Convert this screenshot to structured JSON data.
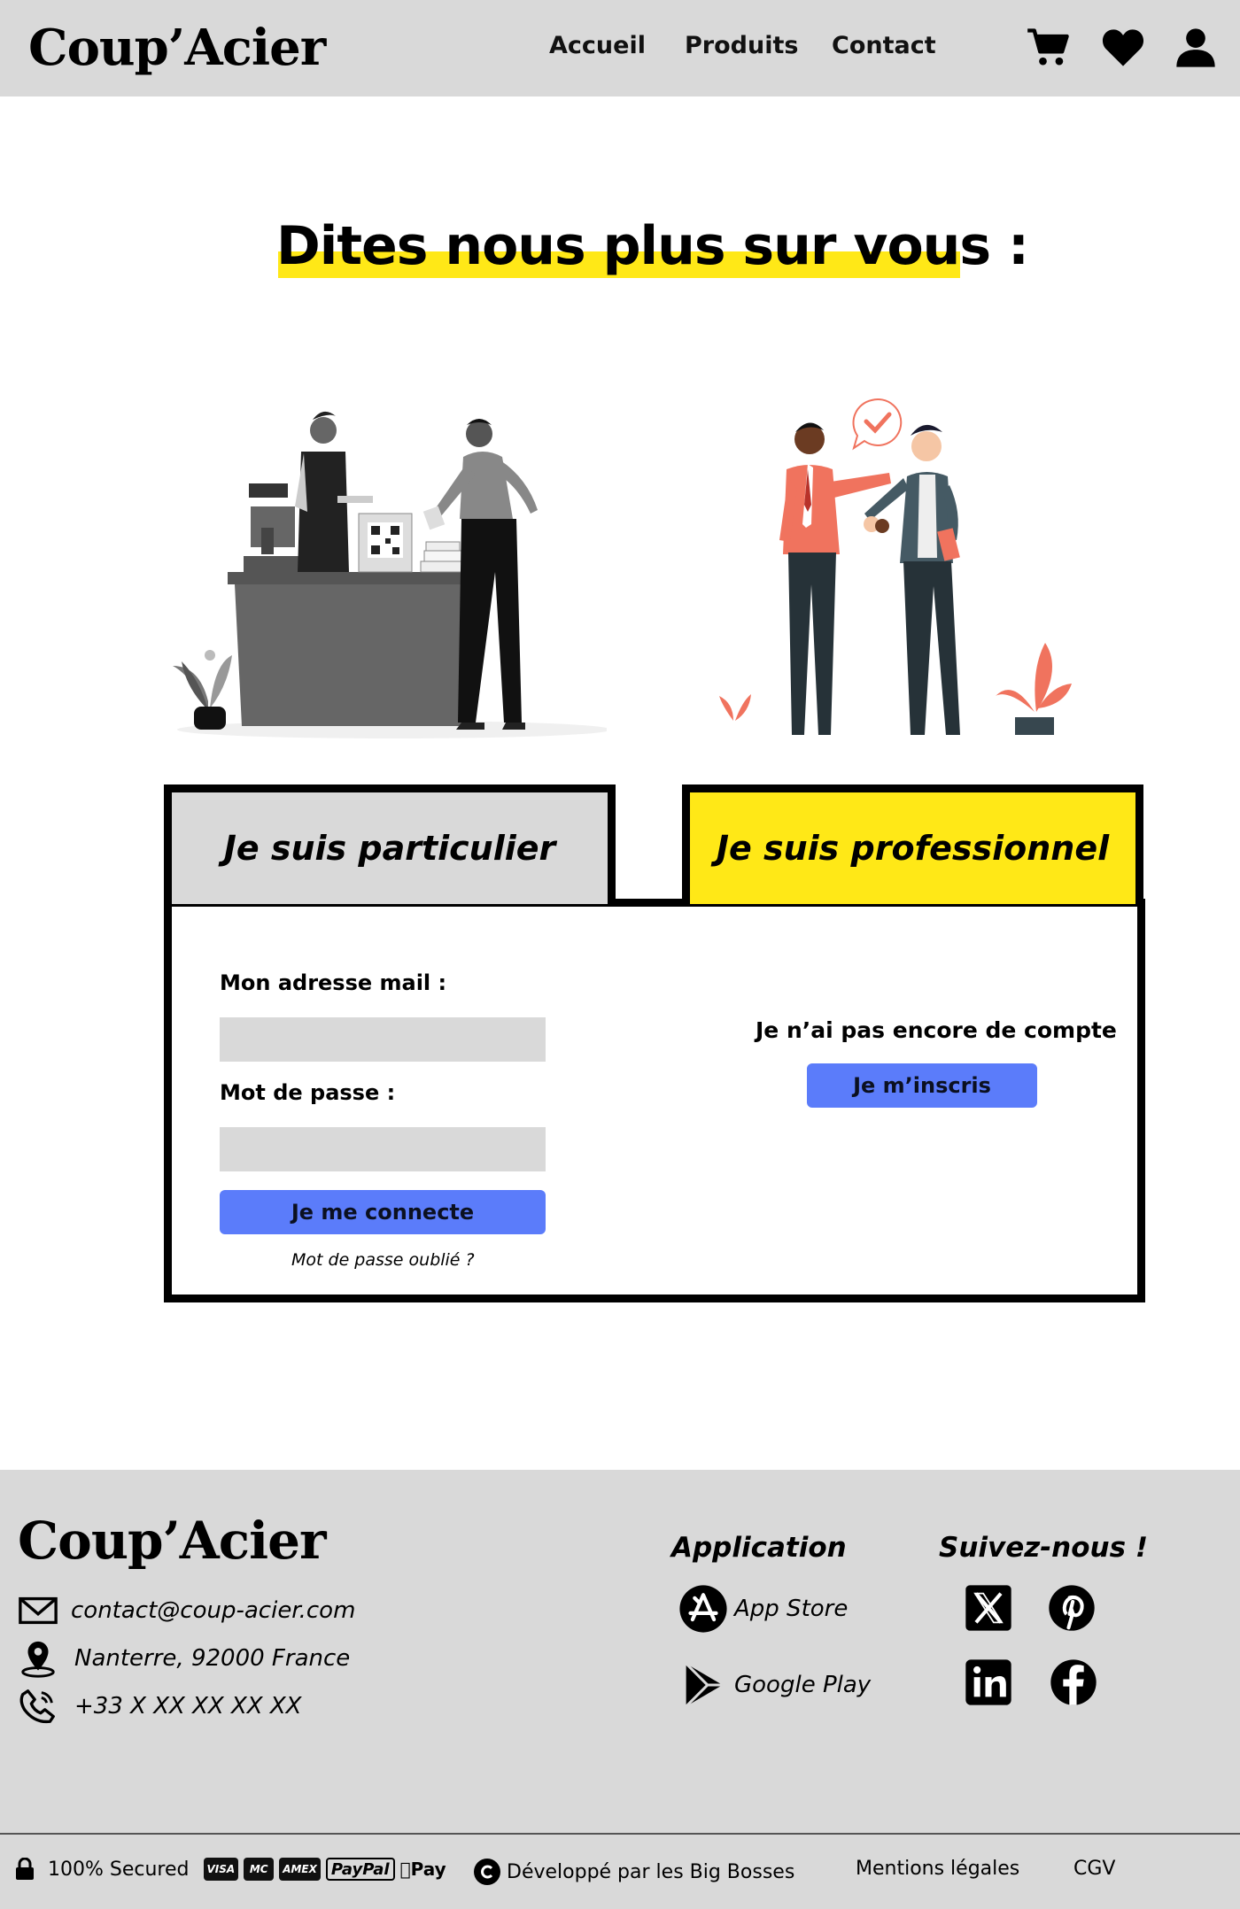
{
  "header": {
    "logo": "Coup’Acier",
    "nav": [
      "Accueil",
      "Produits",
      "Contact"
    ],
    "icons": [
      "cart-icon",
      "heart-icon",
      "user-icon"
    ]
  },
  "main": {
    "title": "Dites nous plus sur vous :",
    "tabs": {
      "particulier": "Je suis particulier",
      "professionnel": "Je suis professionnel"
    },
    "login": {
      "email_label": "Mon adresse mail :",
      "email_value": "",
      "password_label": "Mot de passe :",
      "password_value": "",
      "submit": "Je me connecte",
      "forgot": "Mot de passe oublié ?"
    },
    "signup": {
      "text": "Je n’ai pas encore de compte",
      "button": "Je m’inscris"
    }
  },
  "footer": {
    "logo": "Coup’Acier",
    "contact": {
      "email": "contact@coup-acier.com",
      "address": "Nanterre, 92000 France",
      "phone": "+33 X XX XX XX XX"
    },
    "application": {
      "heading": "Application",
      "app_store": "App Store",
      "google_play": "Google Play"
    },
    "social": {
      "heading": "Suivez-nous !",
      "networks": [
        "x-icon",
        "pinterest-icon",
        "linkedin-icon",
        "facebook-icon"
      ]
    },
    "bottom": {
      "secured": "100% Secured",
      "payments": [
        "VISA",
        "MC",
        "AMEX",
        "PayPal",
        "Pay"
      ],
      "developed": "Développé par les Big Bosses",
      "legal": "Mentions légales",
      "cgv": "CGV"
    }
  },
  "colors": {
    "header_bg": "#d9d9d9",
    "accent_yellow": "#ffe817",
    "button_blue": "#5b7cfa",
    "coral": "#f0735e"
  }
}
